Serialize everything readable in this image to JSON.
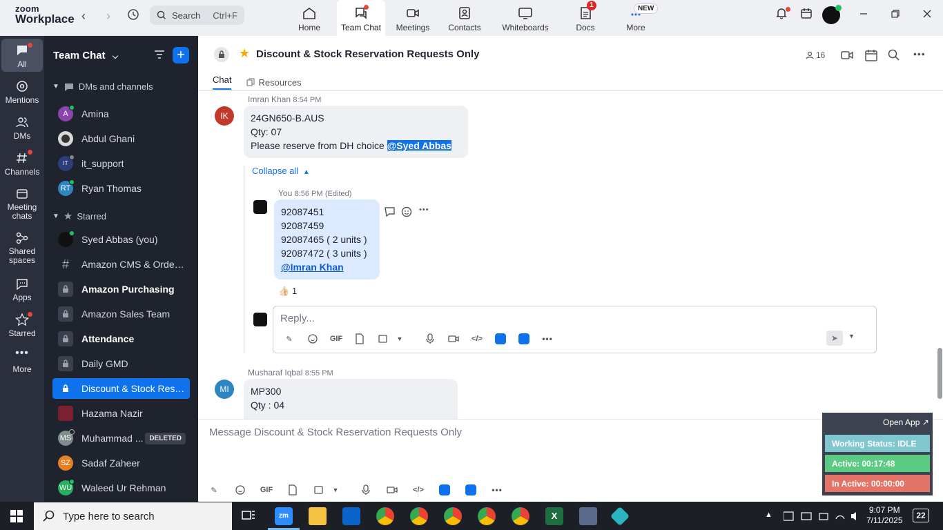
{
  "app": {
    "logo_line1": "zoom",
    "logo_line2": "Workplace",
    "search_placeholder": "Search",
    "search_shortcut": "Ctrl+F",
    "nav_back": "‹",
    "nav_forward": "›"
  },
  "tabs": [
    {
      "label": "Home"
    },
    {
      "label": "Team Chat"
    },
    {
      "label": "Meetings"
    },
    {
      "label": "Contacts"
    },
    {
      "label": "Whiteboards"
    },
    {
      "label": "Docs",
      "badge": "1"
    },
    {
      "label": "More",
      "badge": "NEW"
    }
  ],
  "rail": [
    {
      "label": "All"
    },
    {
      "label": "Mentions"
    },
    {
      "label": "DMs"
    },
    {
      "label": "Channels"
    },
    {
      "label": "Meeting chats"
    },
    {
      "label": "Shared spaces"
    },
    {
      "label": "Apps"
    },
    {
      "label": "Starred"
    },
    {
      "label": "More"
    }
  ],
  "sidebar": {
    "title": "Team Chat",
    "sections": {
      "dms": "DMs and channels",
      "starred": "Starred"
    },
    "items": [
      {
        "name": "Amina",
        "initials": "A",
        "color": "#8e44ad"
      },
      {
        "name": "Abdul Ghani",
        "initials": "",
        "color": "#d9d9d9"
      },
      {
        "name": "it_support",
        "initials": "IT",
        "color": "#2c3e7a"
      },
      {
        "name": "Ryan Thomas",
        "initials": "RT",
        "color": "#2e86c1"
      },
      {
        "name": "Syed Abbas (you)",
        "initials": "",
        "color": "#222"
      },
      {
        "name": "Amazon CMS & OrderA...",
        "initials": "#",
        "color": "#3b404c"
      },
      {
        "name": "Amazon Purchasing",
        "initials": "",
        "color": "#3b404c"
      },
      {
        "name": "Amazon Sales Team",
        "initials": "",
        "color": "#3b404c"
      },
      {
        "name": "Attendance",
        "initials": "",
        "color": "#3b404c"
      },
      {
        "name": "Daily GMD",
        "initials": "",
        "color": "#3b404c"
      },
      {
        "name": "Discount & Stock Reser...",
        "initials": "",
        "color": "#0e72ed"
      },
      {
        "name": "Hazama Nazir",
        "initials": "",
        "color": "#7a2030"
      },
      {
        "name": "Muhammad ...",
        "initials": "MS",
        "color": "#7f8c8d",
        "badge": "DELETED"
      },
      {
        "name": "Sadaf Zaheer",
        "initials": "SZ",
        "color": "#e67e22"
      },
      {
        "name": "Waleed Ur Rehman",
        "initials": "WU",
        "color": "#27ae60"
      }
    ]
  },
  "channel": {
    "title": "Discount & Stock Reservation Requests Only",
    "member_count": "16",
    "tabs": [
      "Chat",
      "Resources"
    ]
  },
  "messages": {
    "m1": {
      "initials": "IK",
      "sender": "Imran Khan",
      "time": "8:54 PM",
      "lines": [
        "24GN650-B.AUS",
        "Qty: 07",
        "Please reserve from DH choice "
      ],
      "mention": "@Syed Abbas"
    },
    "collapse": "Collapse all",
    "reply": {
      "sender": "You",
      "time": "8:56 PM",
      "edited": "(Edited)",
      "lines": [
        "92087451",
        "92087459",
        "92087465 ( 2 units )",
        "92087472 ( 3 units )"
      ],
      "mention": "@Imran Khan",
      "reaction_emoji": "👍🏻",
      "reaction_count": "1"
    },
    "reply_placeholder": "Reply...",
    "m2": {
      "initials": "MI",
      "sender": "Musharaf Iqbal",
      "time": "8:55 PM",
      "lines": [
        "MP300",
        "Qty : 04"
      ]
    }
  },
  "composer": {
    "placeholder": "Message Discount & Stock Reservation Requests Only",
    "gif": "GIF"
  },
  "widget": {
    "open_app": "Open App ↗",
    "status": "Working Status: IDLE",
    "active": "Active: 00:17:48",
    "inactive": "In Active: 00:00:00",
    "colors": {
      "status": "#7fc6cf",
      "active": "#5ccb82",
      "inactive": "#e47368"
    }
  },
  "taskbar": {
    "search": "Type here to search",
    "time": "9:07 PM",
    "date": "7/11/2025",
    "notif_count": "22"
  }
}
